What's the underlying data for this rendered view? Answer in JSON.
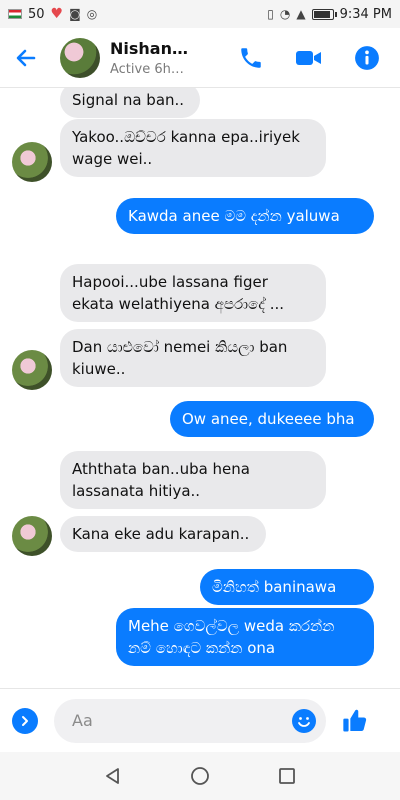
{
  "status_bar": {
    "battery_text": "50",
    "time": "9:34 PM"
  },
  "header": {
    "contact_name": "Nishant…",
    "contact_status": "Active 6h…"
  },
  "messages": [
    {
      "direction": "incoming",
      "text": "Signal na ban.."
    },
    {
      "direction": "incoming",
      "text": "Yakoo..ඔච්චර kanna epa..iriyek wage wei.."
    },
    {
      "direction": "outgoing",
      "text": "Kawda anee මම දන්න yaluwa"
    },
    {
      "direction": "incoming",
      "text": "Hapooi...ube lassana figer ekata welathiyena අපරාදේ ..."
    },
    {
      "direction": "incoming",
      "text": "Dan යාළුවෝ nemei කියලා ban kiuwe.."
    },
    {
      "direction": "outgoing",
      "text": "Ow anee, dukeeee bha"
    },
    {
      "direction": "incoming",
      "text": "Aththata ban..uba hena lassanata hitiya.."
    },
    {
      "direction": "incoming",
      "text": "Kana eke adu karapan.."
    },
    {
      "direction": "outgoing",
      "text": "මිනිහත් baninawa"
    },
    {
      "direction": "outgoing",
      "text": "Mehe ගෙවල්වල weda කරන්න නම් හොඳට කන්න ona"
    }
  ],
  "composer": {
    "placeholder": "Aa"
  },
  "colors": {
    "accent": "#0a7cff",
    "incoming_bubble": "#e9e9eb"
  },
  "icons": [
    "back-arrow-icon",
    "phone-icon",
    "video-icon",
    "info-icon",
    "chevron-right-icon",
    "emoji-icon",
    "thumbs-up-icon",
    "nav-back-icon",
    "nav-home-icon",
    "nav-recents-icon"
  ]
}
